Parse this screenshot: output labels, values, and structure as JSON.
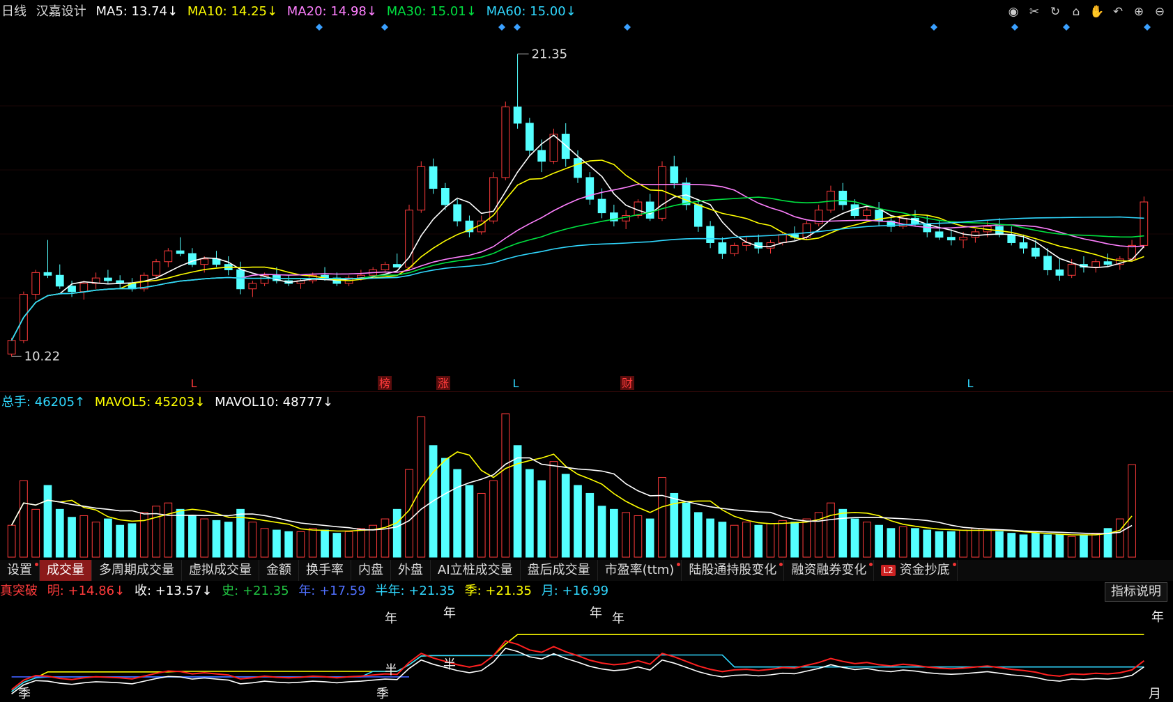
{
  "price_header": {
    "period": "日线",
    "stock_name": "汉嘉设计",
    "ma5": "MA5: 13.74↓",
    "ma10": "MA10: 14.25↓",
    "ma20": "MA20: 14.98↓",
    "ma30": "MA30: 15.01↓",
    "ma60": "MA60: 15.00↓"
  },
  "price_annotations": {
    "high_label": "21.35",
    "low_label": "10.22"
  },
  "event_marks": [
    "L",
    "榜",
    "涨",
    "L",
    "财",
    "L"
  ],
  "volume_header": {
    "total": "总手: 46205↑",
    "mavol5": "MAVOL5: 45203↓",
    "mavol10": "MAVOL10: 48777↓"
  },
  "tabs": [
    {
      "label": "设置",
      "dot": true
    },
    {
      "label": "成交量",
      "active": true
    },
    {
      "label": "多周期成交量"
    },
    {
      "label": "虚拟成交量"
    },
    {
      "label": "金额"
    },
    {
      "label": "换手率"
    },
    {
      "label": "内盘"
    },
    {
      "label": "外盘"
    },
    {
      "label": "AI立桩成交量"
    },
    {
      "label": "盘后成交量"
    },
    {
      "label": "市盈率(ttm)",
      "dot": true
    },
    {
      "label": "陆股通持股变化",
      "dot": true
    },
    {
      "label": "融资融券变化",
      "dot": true
    },
    {
      "label": "资金抄底",
      "dot": true,
      "badge": "L2"
    }
  ],
  "indicator_header": {
    "name": "真突破",
    "ming": "明: +14.86↓",
    "shou": "收: +13.57↓",
    "shi": "史: +21.35",
    "nian": "年: +17.59",
    "bannian": "半年: +21.35",
    "ji": "季: +21.35",
    "yue": "月: +16.99"
  },
  "indicator_button": "指标说明",
  "indicator_labels": [
    "年",
    "年",
    "年",
    "年",
    "年",
    "季",
    "半",
    "季",
    "半",
    "月"
  ],
  "icons": [
    "eye-icon",
    "scissors-icon",
    "refresh-icon",
    "lock-icon",
    "hand-icon",
    "undo-icon",
    "zoom-in-icon",
    "zoom-out-icon"
  ],
  "colors": {
    "up": "#ff3b3b",
    "down": "#54ffff",
    "ma5": "#ffffff",
    "ma10": "#ffff00",
    "ma20": "#ff80ff",
    "ma30": "#00e040",
    "ma60": "#30d8ff"
  },
  "chart_data": {
    "type": "candlestick",
    "price_high": 21.35,
    "price_low": 10.22,
    "candles": [
      [
        10.3,
        10.9,
        10.2,
        10.8
      ],
      [
        10.8,
        12.6,
        10.7,
        12.5
      ],
      [
        12.5,
        13.4,
        12.3,
        13.3
      ],
      [
        13.3,
        14.5,
        13.1,
        13.2
      ],
      [
        13.2,
        13.6,
        12.7,
        12.8
      ],
      [
        12.8,
        13.0,
        12.4,
        12.6
      ],
      [
        12.6,
        13.0,
        12.3,
        12.9
      ],
      [
        12.9,
        13.3,
        12.7,
        13.1
      ],
      [
        13.1,
        13.4,
        12.9,
        13.0
      ],
      [
        13.0,
        13.2,
        12.7,
        12.9
      ],
      [
        12.9,
        13.1,
        12.6,
        12.7
      ],
      [
        12.7,
        13.3,
        12.6,
        13.2
      ],
      [
        13.2,
        13.8,
        13.1,
        13.7
      ],
      [
        13.7,
        14.2,
        13.5,
        14.1
      ],
      [
        14.1,
        14.6,
        13.9,
        14.0
      ],
      [
        14.0,
        14.2,
        13.5,
        13.6
      ],
      [
        13.6,
        13.9,
        13.3,
        13.8
      ],
      [
        13.8,
        14.1,
        13.5,
        13.6
      ],
      [
        13.6,
        13.9,
        13.2,
        13.4
      ],
      [
        13.4,
        13.7,
        12.5,
        12.7
      ],
      [
        12.7,
        13.0,
        12.4,
        12.9
      ],
      [
        12.9,
        13.3,
        12.8,
        13.2
      ],
      [
        13.2,
        13.5,
        12.9,
        13.0
      ],
      [
        13.0,
        13.2,
        12.8,
        12.9
      ],
      [
        12.9,
        13.1,
        12.7,
        13.0
      ],
      [
        13.0,
        13.3,
        12.9,
        13.2
      ],
      [
        13.2,
        13.5,
        13.0,
        13.1
      ],
      [
        13.1,
        13.3,
        12.8,
        12.9
      ],
      [
        12.9,
        13.2,
        12.8,
        13.1
      ],
      [
        13.1,
        13.4,
        13.0,
        13.2
      ],
      [
        13.2,
        13.5,
        13.1,
        13.4
      ],
      [
        13.4,
        13.7,
        13.3,
        13.6
      ],
      [
        13.6,
        14.0,
        13.5,
        13.5
      ],
      [
        13.5,
        15.8,
        13.4,
        15.6
      ],
      [
        15.6,
        17.4,
        15.5,
        17.2
      ],
      [
        17.2,
        17.5,
        16.2,
        16.4
      ],
      [
        16.4,
        16.6,
        15.6,
        15.8
      ],
      [
        15.8,
        16.0,
        15.0,
        15.2
      ],
      [
        15.2,
        15.4,
        14.6,
        14.8
      ],
      [
        14.8,
        15.4,
        14.7,
        15.2
      ],
      [
        15.2,
        17.0,
        15.1,
        16.8
      ],
      [
        16.8,
        19.6,
        16.7,
        19.4
      ],
      [
        19.4,
        21.35,
        18.6,
        18.8
      ],
      [
        18.8,
        19.0,
        17.6,
        17.8
      ],
      [
        17.8,
        18.2,
        17.0,
        17.4
      ],
      [
        17.4,
        18.6,
        17.3,
        18.4
      ],
      [
        18.4,
        18.8,
        17.2,
        17.5
      ],
      [
        17.5,
        17.8,
        16.6,
        16.8
      ],
      [
        16.8,
        17.0,
        15.8,
        16.0
      ],
      [
        16.0,
        16.4,
        15.3,
        15.5
      ],
      [
        15.5,
        15.8,
        15.0,
        15.2
      ],
      [
        15.2,
        15.6,
        14.9,
        15.4
      ],
      [
        15.4,
        16.0,
        15.3,
        15.9
      ],
      [
        15.9,
        16.2,
        15.2,
        15.3
      ],
      [
        15.3,
        17.4,
        15.2,
        17.2
      ],
      [
        17.2,
        17.6,
        16.4,
        16.6
      ],
      [
        16.6,
        16.8,
        15.6,
        15.8
      ],
      [
        15.8,
        16.0,
        14.8,
        15.0
      ],
      [
        15.0,
        15.2,
        14.2,
        14.4
      ],
      [
        14.4,
        14.6,
        13.8,
        14.0
      ],
      [
        14.0,
        14.4,
        13.9,
        14.3
      ],
      [
        14.3,
        14.6,
        14.1,
        14.4
      ],
      [
        14.4,
        14.7,
        14.0,
        14.2
      ],
      [
        14.2,
        14.5,
        14.0,
        14.4
      ],
      [
        14.4,
        14.8,
        14.3,
        14.7
      ],
      [
        14.7,
        15.0,
        14.5,
        14.6
      ],
      [
        14.6,
        15.2,
        14.5,
        15.1
      ],
      [
        15.1,
        15.8,
        15.0,
        15.6
      ],
      [
        15.6,
        16.5,
        15.5,
        16.3
      ],
      [
        16.3,
        16.6,
        15.6,
        15.8
      ],
      [
        15.8,
        16.0,
        15.3,
        15.4
      ],
      [
        15.4,
        15.8,
        15.2,
        15.6
      ],
      [
        15.6,
        15.9,
        15.0,
        15.2
      ],
      [
        15.2,
        15.4,
        14.8,
        15.0
      ],
      [
        15.0,
        15.4,
        14.9,
        15.3
      ],
      [
        15.3,
        15.6,
        15.0,
        15.1
      ],
      [
        15.1,
        15.4,
        14.6,
        14.8
      ],
      [
        14.8,
        15.2,
        14.5,
        14.6
      ],
      [
        14.6,
        14.9,
        14.3,
        14.5
      ],
      [
        14.5,
        14.8,
        14.2,
        14.6
      ],
      [
        14.6,
        14.9,
        14.4,
        14.8
      ],
      [
        14.8,
        15.2,
        14.6,
        15.0
      ],
      [
        15.0,
        15.3,
        14.6,
        14.7
      ],
      [
        14.7,
        15.0,
        14.3,
        14.4
      ],
      [
        14.4,
        14.7,
        14.0,
        14.2
      ],
      [
        14.2,
        14.5,
        13.8,
        13.9
      ],
      [
        13.9,
        14.2,
        13.2,
        13.4
      ],
      [
        13.4,
        13.8,
        13.0,
        13.2
      ],
      [
        13.2,
        13.8,
        13.1,
        13.6
      ],
      [
        13.6,
        13.9,
        13.3,
        13.5
      ],
      [
        13.5,
        13.8,
        13.3,
        13.7
      ],
      [
        13.7,
        14.0,
        13.5,
        13.6
      ],
      [
        13.6,
        13.9,
        13.4,
        13.8
      ],
      [
        13.8,
        14.5,
        13.7,
        14.3
      ],
      [
        14.3,
        16.1,
        14.2,
        15.9
      ]
    ],
    "volume": [
      20,
      48,
      30,
      45,
      30,
      25,
      26,
      22,
      24,
      20,
      21,
      28,
      32,
      34,
      30,
      26,
      24,
      23,
      22,
      30,
      22,
      18,
      17,
      16,
      16,
      18,
      17,
      15,
      16,
      18,
      20,
      24,
      30,
      55,
      88,
      70,
      62,
      55,
      45,
      40,
      48,
      90,
      70,
      55,
      48,
      60,
      52,
      45,
      40,
      32,
      30,
      28,
      26,
      24,
      50,
      40,
      34,
      28,
      24,
      22,
      20,
      22,
      20,
      21,
      23,
      22,
      24,
      28,
      34,
      30,
      24,
      22,
      20,
      18,
      19,
      18,
      17,
      16,
      16,
      17,
      18,
      17,
      16,
      15,
      14,
      15,
      14,
      14,
      13,
      14,
      15,
      18,
      24,
      58
    ],
    "indicator": {
      "series": [
        {
          "name": "明",
          "color": "#ff2020"
        },
        {
          "name": "收",
          "color": "#ffffff"
        },
        {
          "name": "史",
          "color": "#ffff00"
        },
        {
          "name": "年",
          "color": "#4060ff"
        },
        {
          "name": "季",
          "color": "#30d8ff"
        }
      ]
    }
  }
}
